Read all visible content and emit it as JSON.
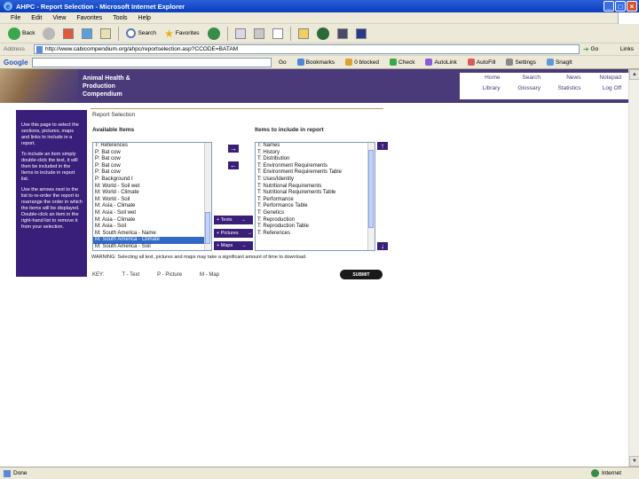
{
  "window": {
    "title": "AHPC - Report Selection - Microsoft Internet Explorer",
    "controls": [
      "_",
      "□",
      "×"
    ]
  },
  "menu": [
    "File",
    "Edit",
    "View",
    "Favorites",
    "Tools",
    "Help"
  ],
  "toolbar": {
    "back": "Back",
    "search": "Search",
    "favorites": "Favorites"
  },
  "address": {
    "label": "Address",
    "url": "http://www.cabicompendium.org/ahpc/reportselection.asp?CCODE=BATAM",
    "go": "Go",
    "links": "Links"
  },
  "google": {
    "logo": "Google",
    "go": "Go",
    "bookmarks": "Bookmarks",
    "blocked": "0 blocked",
    "check": "Check",
    "autolink": "AutoLink",
    "autofill": "AutoFill",
    "settings": "Settings",
    "snagit": "SnagIt"
  },
  "site": {
    "title_line1": "Animal Health &",
    "title_line2": "Production",
    "title_line3": "Compendium",
    "nav": [
      "Home",
      "|",
      "Search",
      "|",
      "News",
      "|",
      "Notepad",
      "|",
      "Library",
      "|",
      "Glossary",
      "|",
      "Statistics",
      "|",
      "Log Off"
    ]
  },
  "side_panel": {
    "p1": "Use this page to select the sections, pictures, maps and links to include in a report.",
    "p2": "To include an item simply double-click the text, it will then be included in the Items to include in report list.",
    "p3": "Use the arrows next to the list to re-order the report to rearrange the order in which the items will be displayed. Double-click an item in the right-hand list to remove it from your selection."
  },
  "report": {
    "crumb": "Report Selection",
    "available_title": "Available Items",
    "include_title": "Items to include in report",
    "available_items": [
      "T: References",
      "P: Bat cow",
      "P: Bat cow",
      "P: Bat cow",
      "P: Bat cow",
      "P: Background I",
      "M: World - Soil wet",
      "M: World - Climate",
      "M: World - Soil",
      "M: Asia - Climate",
      "M: Asia - Soil wet",
      "M: Asia - Climate",
      "M: Asia - Soil",
      "M: South America - Name",
      "M: South America - Climate",
      "M: South America - Soil"
    ],
    "available_selected_index": 14,
    "include_items": [
      "T: Names",
      "T: History",
      "T: Distribution",
      "T: Environment Requirements",
      "T: Environment Requirements Table",
      "T: Uses/Identity",
      "T: Nutritional Requirements",
      "T: Nutritional Requirements Table",
      "T: Performance",
      "T: Performance Table",
      "T: Genetics",
      "T: Reproduction",
      "T: Reproduction Table",
      "T: References"
    ],
    "btn_add": "→",
    "btn_remove": "←",
    "btn_up": "↑",
    "btn_down": "↓",
    "btn_texts": "+ Texts",
    "btn_pictures": "+ Pictures",
    "btn_maps": "+ Maps",
    "warning": "WARNING: Selecting all text, pictures and maps may take a significant amount of time to download.",
    "key_label": "KEY:",
    "key_text": "T - Text",
    "key_picture": "P - Picture",
    "key_map": "M - Map",
    "submit": "SUBMIT"
  },
  "status": {
    "left": "Done",
    "zone": "Internet"
  }
}
